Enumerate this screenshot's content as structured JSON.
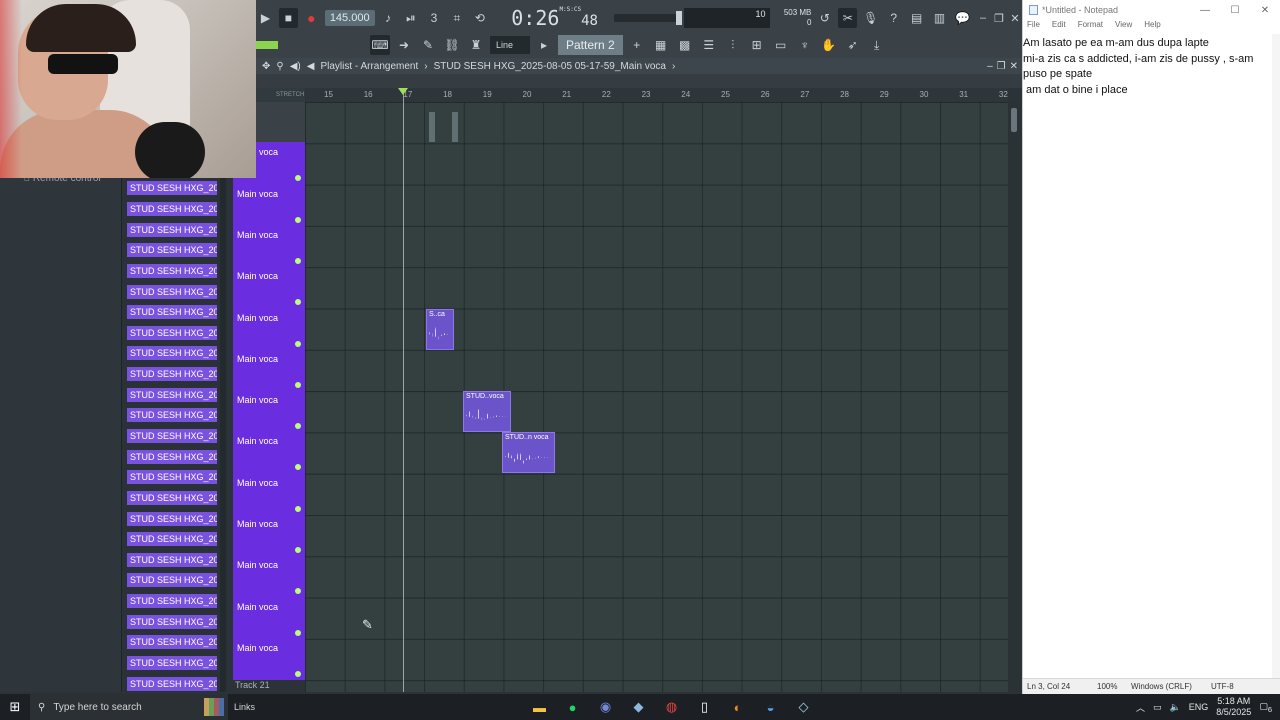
{
  "transport": {
    "tempo": "145.000",
    "time": "0:26",
    "time_small": "48",
    "time_sup": "M:S:CS",
    "cpu_value": "10",
    "memory": "503 MB",
    "memory_sub": "0"
  },
  "toolbar": {
    "snap_label": "Line",
    "pattern_label": "Pattern 2"
  },
  "playlist": {
    "title": "Playlist - Arrangement",
    "project": "STUD SESH HXG_2025-08-05 05-17-59_Main voca",
    "ruler_ticks": [
      "15",
      "16",
      "17",
      "18",
      "19",
      "20",
      "21",
      "22",
      "23",
      "24",
      "25",
      "26",
      "27",
      "28",
      "29",
      "30",
      "31",
      "32"
    ],
    "stretch_label": "STRETCH",
    "track_label": "Main voca",
    "last_track": "Track 21",
    "clips": [
      {
        "label": "S..ca"
      },
      {
        "label": "STUD..voca"
      },
      {
        "label": "STUD..n voca"
      }
    ]
  },
  "browser": {
    "remote_label": "Remote control",
    "file_label": "STUD SESH HXG_2025-08..",
    "file_count": 25
  },
  "notepad": {
    "title": "*Untitled - Notepad",
    "menu": [
      "File",
      "Edit",
      "Format",
      "View",
      "Help"
    ],
    "lines": [
      "Am lasato pe ea m-am dus dupa lapte",
      "mi-a zis ca s addicted, i-am zis de pussy , s-am puso pe spate",
      " am dat o bine i place"
    ],
    "status": {
      "position": "Ln 3, Col 24",
      "zoom": "100%",
      "eol": "Windows (CRLF)",
      "encoding": "UTF-8"
    }
  },
  "taskbar": {
    "search_placeholder": "Type here to search",
    "links_label": "Links",
    "language": "ENG",
    "time": "5:18 AM",
    "date": "8/5/2025",
    "notification_count": "6"
  },
  "colors": {
    "track_color": "#6b2de0",
    "clip_color": "#6b54c9",
    "file_color": "#7a52e0",
    "record": "#e23b3b"
  }
}
